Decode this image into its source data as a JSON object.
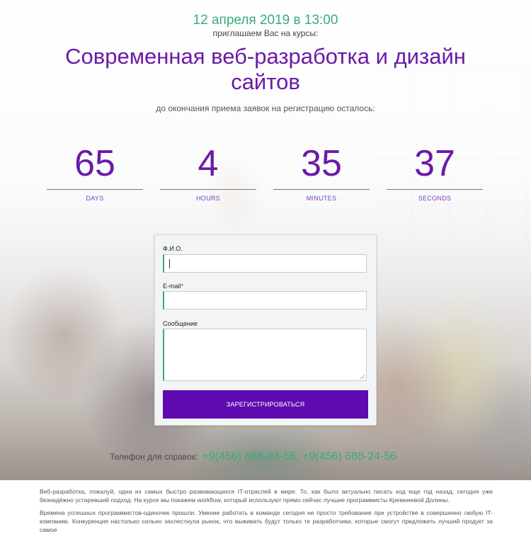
{
  "event": {
    "date": "12 апреля 2019 в 13:00",
    "invite": "приглашаем Вас на курсы:",
    "title": "Современная веб-разработка и дизайн сайтов",
    "deadline": "до окончания приема заявок на регистрацию осталось:"
  },
  "countdown": [
    {
      "value": "65",
      "label": "DAYS"
    },
    {
      "value": "4",
      "label": "HOURS"
    },
    {
      "value": "35",
      "label": "MINUTES"
    },
    {
      "value": "37",
      "label": "SECONDS"
    }
  ],
  "form": {
    "name_label": "Ф.И.О.",
    "name_value": "",
    "email_label": "E-mail",
    "email_required_mark": "*",
    "email_value": "",
    "message_label": "Сообщение",
    "message_value": "",
    "submit_label": "ЗАРЕГИСТРИРОВАТЬСЯ"
  },
  "contact": {
    "phone_label": "Телефон для справок:",
    "phone_numbers": "+9(456) 688-24-56, +9(456) 688-24-56"
  },
  "description": {
    "paragraph_1": "Веб-разработка, пожалуй, одна из самых быстро развивающихся IT-отраслей в мире. То, как было актуально писать код еще год назад, сегодня уже безнадёжно устаревший подход. На курсе мы покажем workflow, который используют прямо сейчас лучшие программисты Кремниевой Долины.",
    "paragraph_2": "Времена успешных программистов-одиночек прошли. Умение работать в команде сегодня не просто требование при устройстве в совершенно любую IT-компанию. Конкуренция настолько сильно захлестнула рынок, что выживать будут только те разработчики, которые смогут предложить лучший продукт за самое"
  },
  "colors": {
    "accent_purple": "#6a1aa8",
    "button_purple": "#5d0bb0",
    "accent_green": "#3bab77"
  }
}
